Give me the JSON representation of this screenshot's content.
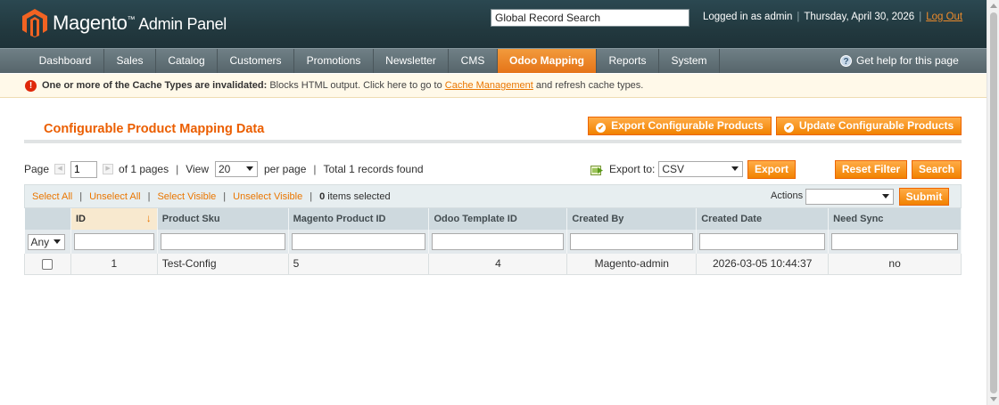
{
  "header": {
    "brand": "Magento",
    "brand_tm": "™",
    "brand_sub": "Admin Panel",
    "search_value": "Global Record Search",
    "logged_in": "Logged in as admin",
    "date": "Thursday, April 30, 2026",
    "logout": "Log Out"
  },
  "nav": {
    "items": [
      {
        "label": "Dashboard"
      },
      {
        "label": "Sales"
      },
      {
        "label": "Catalog"
      },
      {
        "label": "Customers"
      },
      {
        "label": "Promotions"
      },
      {
        "label": "Newsletter"
      },
      {
        "label": "CMS"
      },
      {
        "label": "Odoo Mapping"
      },
      {
        "label": "Reports"
      },
      {
        "label": "System"
      }
    ],
    "active": "Odoo Mapping",
    "help": "Get help for this page"
  },
  "notice": {
    "bold": "One or more of the Cache Types are invalidated:",
    "text1": " Blocks HTML output. Click here to go to ",
    "link": "Cache Management",
    "text2": " and refresh cache types."
  },
  "page": {
    "title": "Configurable Product Mapping Data",
    "export_btn": "Export Configurable Products",
    "update_btn": "Update Configurable Products"
  },
  "pager": {
    "page_label": "Page",
    "page_value": "1",
    "of_pages": "of 1 pages",
    "view_label": "View",
    "view_value": "20",
    "per_page": "per page",
    "records": "Total 1 records found",
    "export_to": "Export to:",
    "export_format": "CSV",
    "export_btn": "Export",
    "reset_btn": "Reset Filter",
    "search_btn": "Search"
  },
  "massaction": {
    "select_all": "Select All",
    "unselect_all": "Unselect All",
    "select_visible": "Select Visible",
    "unselect_visible": "Unselect Visible",
    "count": "0",
    "count_label": " items selected",
    "actions_label": "Actions",
    "submit": "Submit"
  },
  "grid": {
    "columns": [
      "ID",
      "Product Sku",
      "Magento Product ID",
      "Odoo Template ID",
      "Created By",
      "Created Date",
      "Need Sync"
    ],
    "filter_any": "Any",
    "rows": [
      {
        "id": "1",
        "sku": "Test-Config",
        "magento_id": "5",
        "odoo_template_id": "4",
        "created_by": "Magento-admin",
        "created_date": "2026-03-05 10:44:37",
        "need_sync": "no"
      }
    ]
  },
  "colors": {
    "accent": "#eb5e00",
    "button": "#f18200",
    "header_bg": "#22393f",
    "nav_bg": "#5e6d73"
  }
}
